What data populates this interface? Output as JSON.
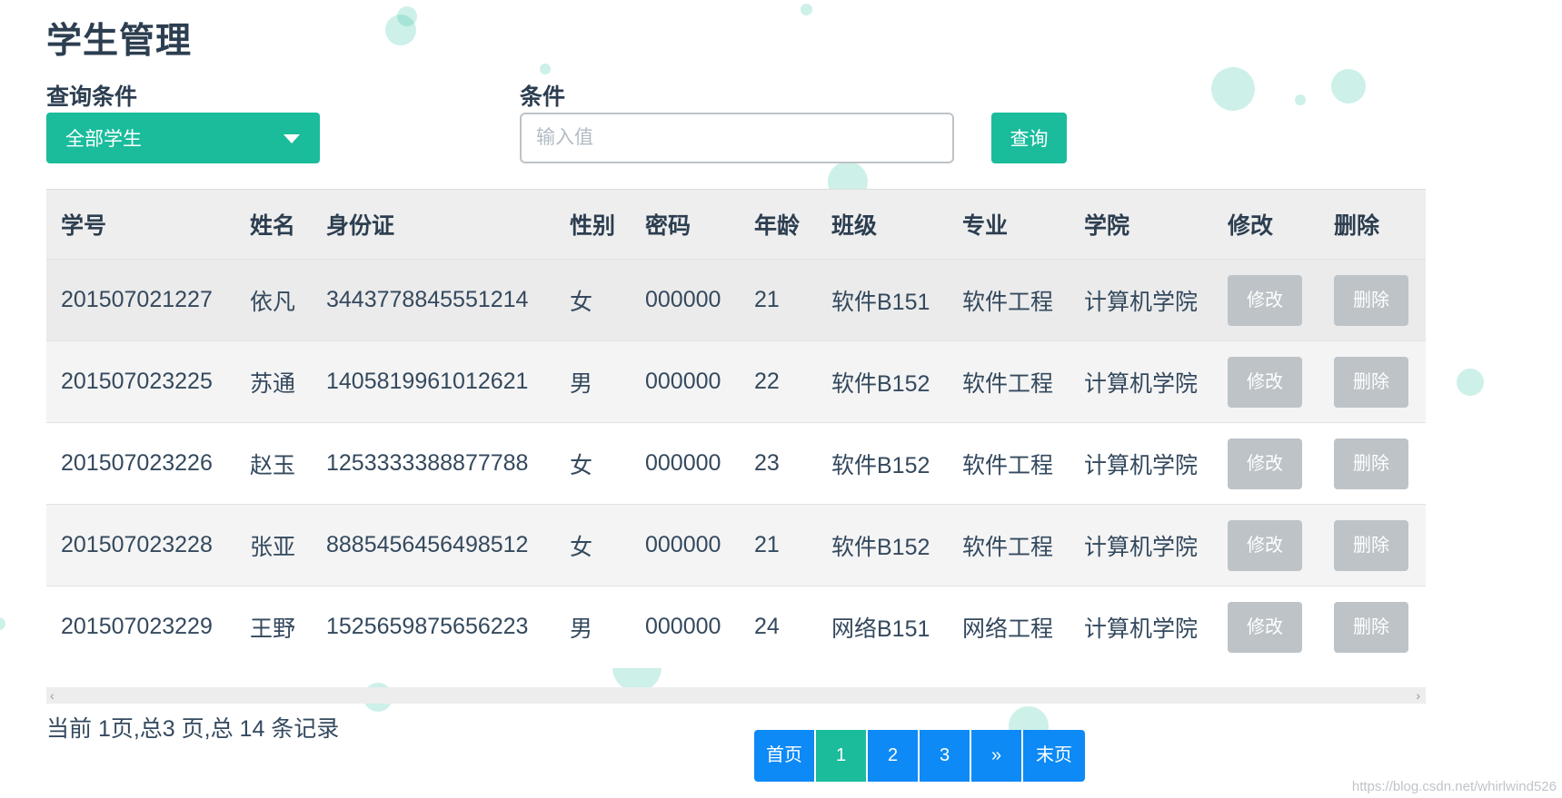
{
  "page": {
    "title": "学生管理"
  },
  "filters": {
    "condition_label": "查询条件",
    "condition_selected": "全部学生",
    "value_label": "条件",
    "value_placeholder": "输入值",
    "query_button": "查询"
  },
  "table": {
    "headers": [
      "学号",
      "姓名",
      "身份证",
      "性别",
      "密码",
      "年龄",
      "班级",
      "专业",
      "学院",
      "修改",
      "删除"
    ],
    "rows": [
      {
        "id": "201507021227",
        "name": "依凡",
        "id_card": "3443778845551214",
        "gender": "女",
        "password": "000000",
        "age": "21",
        "class": "软件B151",
        "major": "软件工程",
        "college": "计算机学院",
        "edit": "修改",
        "delete": "删除"
      },
      {
        "id": "201507023225",
        "name": "苏通",
        "id_card": "1405819961012621",
        "gender": "男",
        "password": "000000",
        "age": "22",
        "class": "软件B152",
        "major": "软件工程",
        "college": "计算机学院",
        "edit": "修改",
        "delete": "删除"
      },
      {
        "id": "201507023226",
        "name": "赵玉",
        "id_card": "1253333388877788",
        "gender": "女",
        "password": "000000",
        "age": "23",
        "class": "软件B152",
        "major": "软件工程",
        "college": "计算机学院",
        "edit": "修改",
        "delete": "删除"
      },
      {
        "id": "201507023228",
        "name": "张亚",
        "id_card": "8885456456498512",
        "gender": "女",
        "password": "000000",
        "age": "21",
        "class": "软件B152",
        "major": "软件工程",
        "college": "计算机学院",
        "edit": "修改",
        "delete": "删除"
      },
      {
        "id": "201507023229",
        "name": "王野",
        "id_card": "1525659875656223",
        "gender": "男",
        "password": "000000",
        "age": "24",
        "class": "网络B151",
        "major": "网络工程",
        "college": "计算机学院",
        "edit": "修改",
        "delete": "删除"
      }
    ]
  },
  "scrollbar": {
    "left": "‹",
    "right": "›"
  },
  "summary": "当前 1页,总3 页,总 14 条记录",
  "pagination": {
    "first": "首页",
    "pages": [
      "1",
      "2",
      "3"
    ],
    "next": "»",
    "last": "末页",
    "current": "1"
  },
  "watermark": "https://blog.csdn.net/whirlwind526",
  "colors": {
    "accent": "#1abc9c",
    "pagination": "#0d8af5",
    "disabled_button": "#bdc3c7"
  }
}
